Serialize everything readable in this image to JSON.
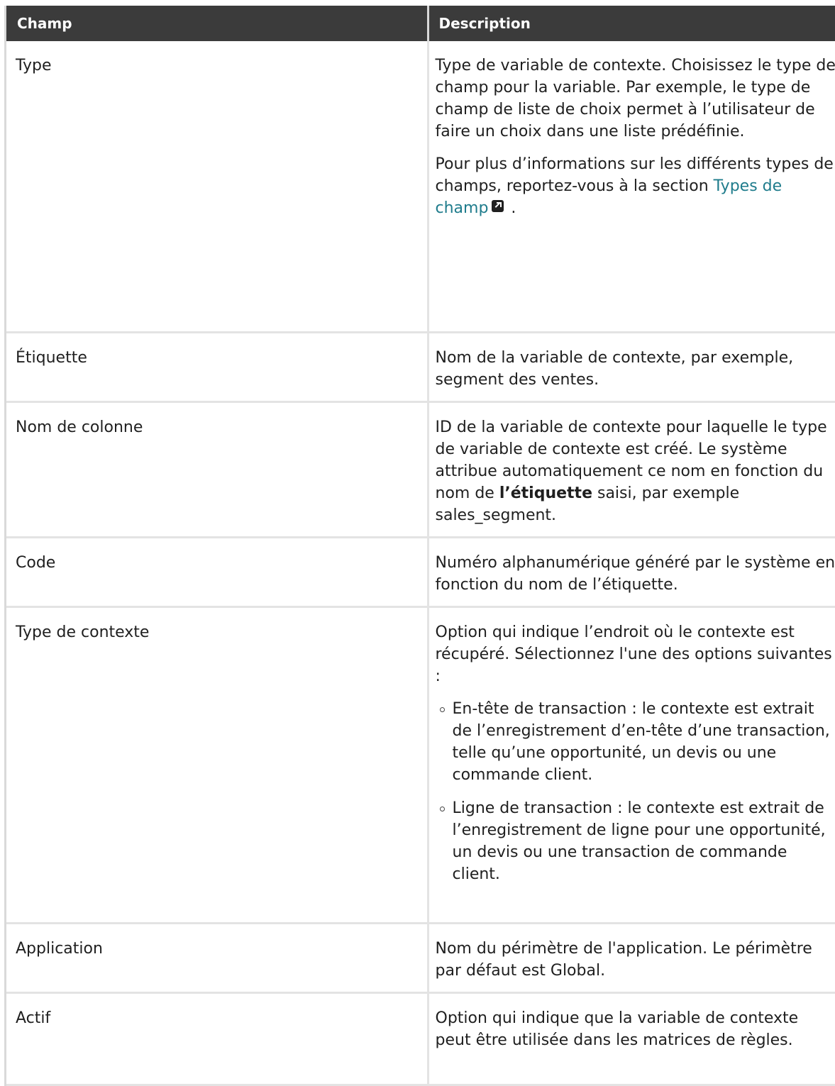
{
  "header": {
    "field": "Champ",
    "description": "Description"
  },
  "rows": {
    "type": {
      "field": "Type",
      "p1": "Type de variable de contexte. Choisissez le type de champ pour la variable. Par exemple, le type de champ de liste de choix permet à l’utilisateur de faire un choix dans une liste prédéfinie.",
      "p2_before": "Pour plus d’informations sur les différents types de champs, reportez-vous à la section ",
      "p2_link": "Types de champ",
      "p2_after": ".",
      "link_icon": "external-link-icon"
    },
    "label": {
      "field": "Étiquette",
      "desc": "Nom de la variable de contexte, par exemple, segment des ventes."
    },
    "column": {
      "field": "Nom de colonne",
      "desc_before": "ID de la variable de contexte pour laquelle le type de variable de contexte est créé. Le système attribue automatiquement ce nom en fonction du nom de ",
      "desc_bold": "l’étiquette",
      "desc_after": " saisi, par exemple sales_segment."
    },
    "code": {
      "field": "Code",
      "desc": "Numéro alphanumérique généré par le système en fonction du nom de l’étiquette."
    },
    "context": {
      "field": "Type de contexte",
      "intro": "Option qui indique l’endroit où le contexte est récupéré. Sélectionnez l'une des options suivantes :",
      "options": [
        "En-tête de transaction : le contexte est extrait de l’enregistrement d’en-tête d’une transaction, telle qu’une opportunité, un devis ou une commande client.",
        "Ligne de transaction : le contexte est extrait de l’enregistrement de ligne pour une opportunité, un devis ou une transaction de commande client."
      ]
    },
    "app": {
      "field": "Application",
      "desc": "Nom du périmètre de l'application. Le périmètre par défaut est Global."
    },
    "active": {
      "field": "Actif",
      "desc": "Option qui indique que la variable de contexte peut être utilisée dans les matrices de règles."
    }
  },
  "colors": {
    "header_bg": "#3b3b3b",
    "link": "#1f7c8c",
    "border": "#e3e3e3"
  }
}
